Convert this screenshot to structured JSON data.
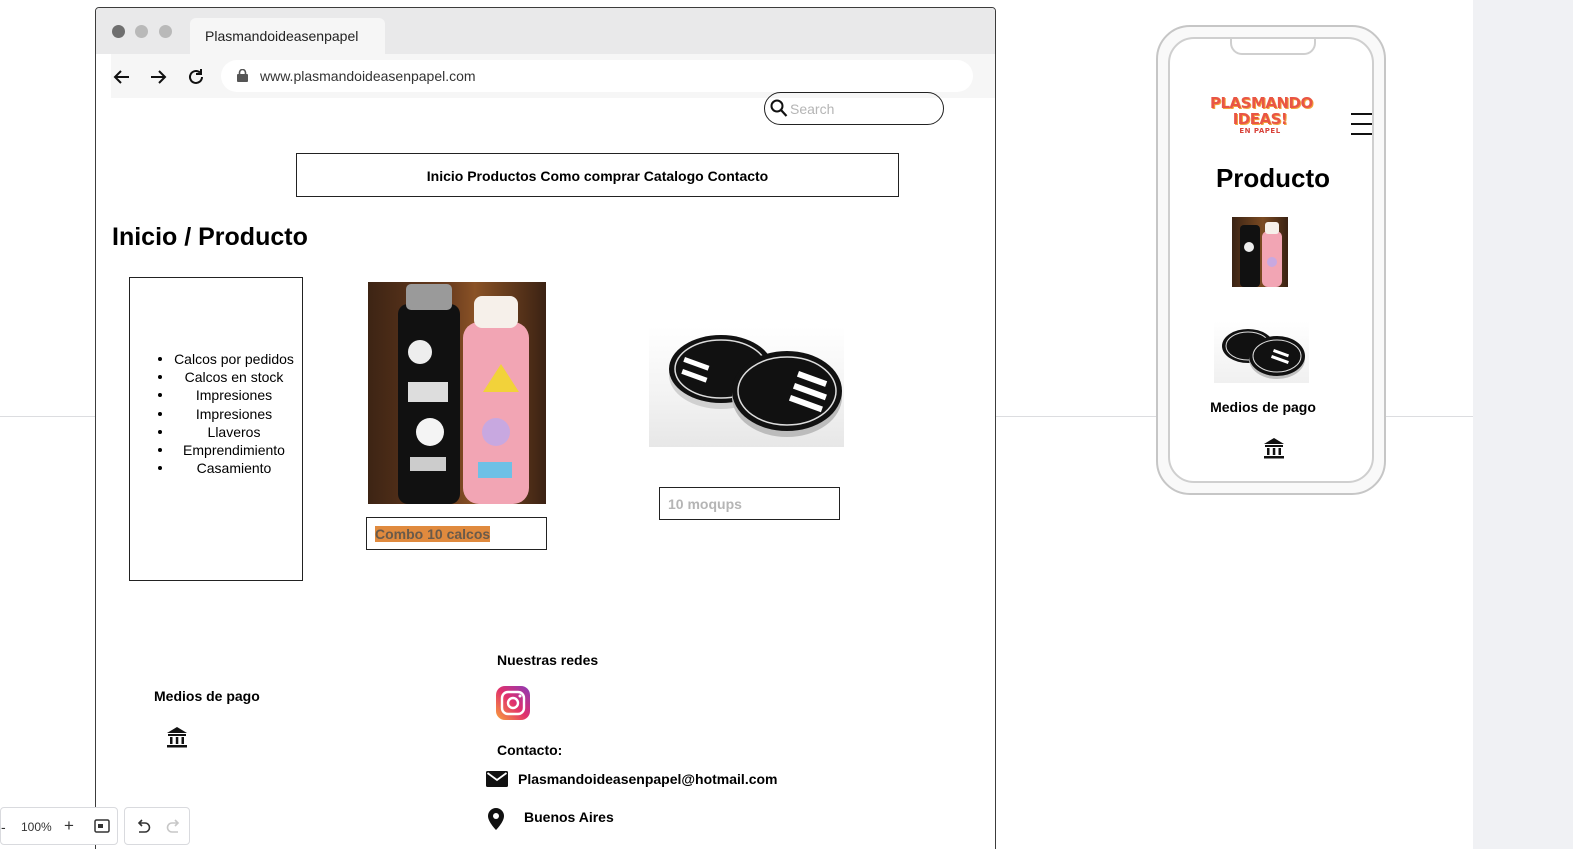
{
  "browser": {
    "tab_title": "Plasmandoideasenpapel",
    "url": "www.plasmandoideasenpapel.com"
  },
  "search": {
    "placeholder": "Search"
  },
  "nav_menu": "Inicio Productos Como comprar Catalogo Contacto",
  "breadcrumb": "Inicio / Producto",
  "categories": [
    "Calcos por pedidos",
    "Calcos en stock",
    "Impresiones",
    "Impresiones",
    "Llaveros",
    "Emprendimiento",
    "Casamiento"
  ],
  "products": [
    {
      "caption": "Combo 10 calcos"
    },
    {
      "caption": "10 moqups"
    }
  ],
  "footer": {
    "payments_title": "Medios de pago",
    "social_title": "Nuestras redes",
    "contact_title": "Contacto:",
    "email": "Plasmandoideasenpapel@hotmail.com",
    "location": "Buenos Aires"
  },
  "zoom": {
    "level": "100%"
  },
  "phone": {
    "logo_line1": "PLASMANDO",
    "logo_line2": "IDEAS!",
    "logo_line3": "EN PAPEL",
    "title": "Producto",
    "payments_title": "Medios de pago"
  },
  "colors": {
    "highlight": "#e08a3e",
    "logo": "#e95545",
    "instagram_start": "#f9a13a",
    "instagram_end": "#8a3ab9"
  },
  "icons": [
    "back-arrow-icon",
    "forward-arrow-icon",
    "reload-icon",
    "lock-icon",
    "search-icon",
    "bank-icon",
    "instagram-icon",
    "mail-icon",
    "location-pin-icon",
    "hamburger-menu-icon",
    "undo-icon",
    "redo-icon",
    "fit-screen-icon"
  ]
}
